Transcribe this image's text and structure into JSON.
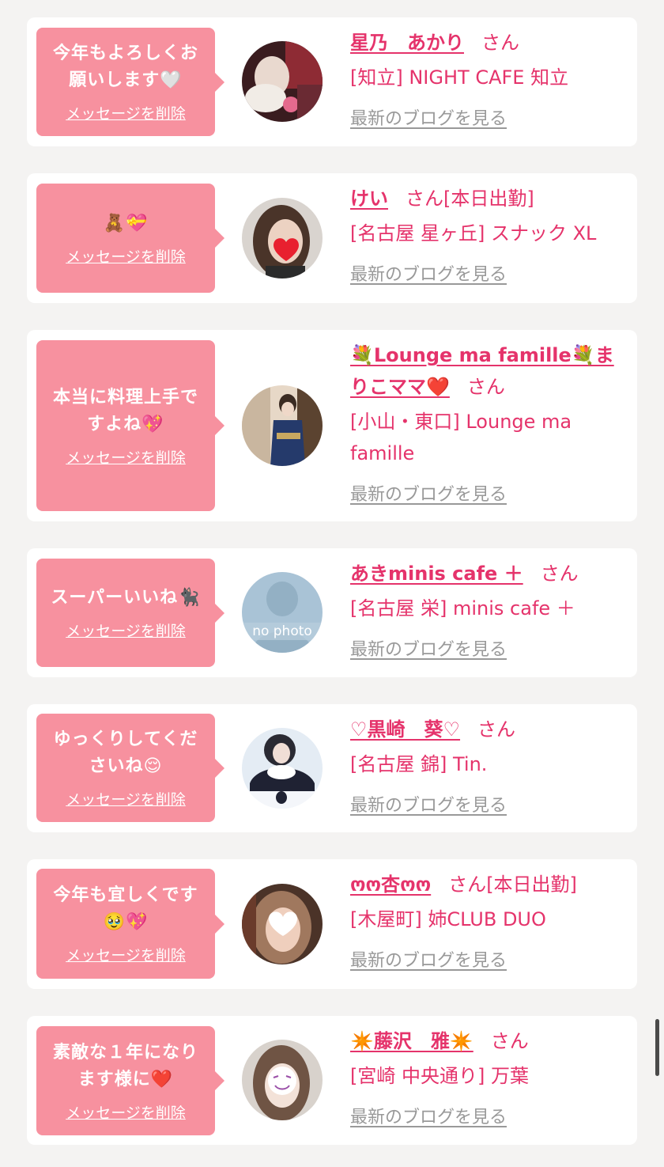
{
  "delete_label": "メッセージを削除",
  "blog_label": "最新のブログを見る",
  "san_label": "さん",
  "colors": {
    "background": "#f4f3f2",
    "card": "#ffffff",
    "bubble": "#f7919f",
    "accent": "#e5336b",
    "link_gray": "#999999"
  },
  "messages": [
    {
      "bubble_text": "今年もよろしくお\n願いします🤍",
      "name": "星乃　あかり",
      "tag": "",
      "shop": "[知立] NIGHT CAFE 知立",
      "avatar_icon": "woman-with-flower-photo"
    },
    {
      "bubble_text": "🧸💝",
      "name": "けい",
      "tag": "[本日出勤]",
      "shop": "[名古屋 星ヶ丘] スナック XL",
      "avatar_icon": "woman-heart-covered-face-photo"
    },
    {
      "bubble_text": "本当に料理上手で\nすよね💖",
      "name": "💐Lounge ma famille💐まりこママ❤️",
      "tag": "",
      "shop": "[小山・東口] Lounge ma famille",
      "avatar_icon": "woman-in-kimono-photo"
    },
    {
      "bubble_text": "スーパーいいね🐈‍⬛",
      "name": "あきminis cafe ＋",
      "tag": "",
      "shop": "[名古屋 栄] minis cafe ＋",
      "avatar_icon": "no-photo-placeholder"
    },
    {
      "bubble_text": "ゆっくりしてくだ\nさいね😌",
      "name": "♡黒崎　葵♡",
      "tag": "",
      "shop": "[名古屋 錦] Tin.",
      "avatar_icon": "woman-in-snow-photo"
    },
    {
      "bubble_text": "今年も宜しくです\n🥹💖",
      "name": "ოო杏ოო",
      "tag": "[本日出勤]",
      "shop": "[木屋町] 姉CLUB DUO",
      "avatar_icon": "woman-heart-covered-face-photo"
    },
    {
      "bubble_text": "素敵な１年になり\nます様に❤️",
      "name": "✴️藤沢　雅✴️",
      "tag": "",
      "shop": "[宮崎 中央通り] 万葉",
      "avatar_icon": "woman-smiley-covered-face-photo"
    }
  ]
}
